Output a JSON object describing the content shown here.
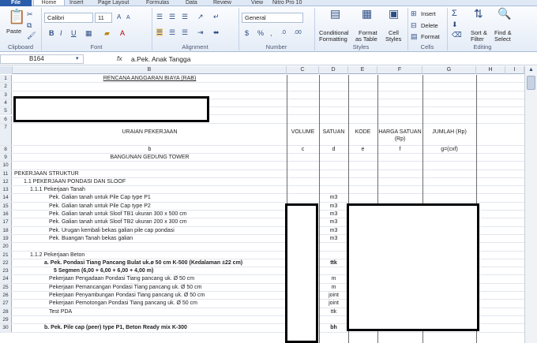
{
  "tabs": {
    "file": "File",
    "home": "Home",
    "insert": "Insert",
    "page_layout": "Page Layout",
    "formulas": "Formulas",
    "data": "Data",
    "review": "Review",
    "view": "View",
    "nitro": "Nitro Pro 10"
  },
  "ribbon": {
    "paste": "Paste",
    "font_name": "Calibri",
    "font_size": "11",
    "number_format": "General",
    "conditional": "Conditional",
    "formatting": "Formatting",
    "format": "Format",
    "as_table": "as Table",
    "cell": "Cell",
    "styles": "Styles",
    "insert": "Insert",
    "delete": "Delete",
    "format_cells": "Format",
    "sum": "Σ",
    "sort": "Sort &",
    "filter": "Filter",
    "find": "Find &",
    "select": "Select",
    "groups": {
      "clipboard": "Clipboard",
      "font": "Font",
      "alignment": "Alignment",
      "number": "Number",
      "styles": "Styles",
      "cells": "Cells",
      "editing": "Editing"
    }
  },
  "formula_bar": {
    "name_box": "B164",
    "fx": "fx",
    "formula": "a.Pek. Anak Tangga"
  },
  "columns": [
    "B",
    "C",
    "D",
    "E",
    "F",
    "G",
    "H",
    "I"
  ],
  "rows": [
    {
      "n": "1",
      "b": "RENCANA ANGGARAN BIAYA (RAB)"
    },
    {
      "n": "2",
      "b": ""
    },
    {
      "n": "3",
      "b": ""
    },
    {
      "n": "4",
      "b": ""
    },
    {
      "n": "5",
      "b": ""
    },
    {
      "n": "6",
      "b": ""
    },
    {
      "n": "7",
      "b": "URAIAN PEKERJAAN",
      "c": "VOLUME",
      "d": "SATUAN",
      "e": "KODE",
      "f": "HARGA SATUAN (Rp)",
      "g": "JUMLAH (Rp)"
    },
    {
      "n": "8",
      "b": "b",
      "c": "c",
      "d": "d",
      "e": "e",
      "f": "f",
      "g": "g=(cxf)"
    },
    {
      "n": "9",
      "b": "BANGUNAN GEDUNG TOWER"
    },
    {
      "n": "10",
      "b": ""
    },
    {
      "n": "11",
      "b": "PEKERJAAN STRUKTUR"
    },
    {
      "n": "12",
      "b": "1.1 PEKERJAAN PONDASI DAN SLOOF"
    },
    {
      "n": "13",
      "b": "1.1.1 Pekerjaan Tanah"
    },
    {
      "n": "14",
      "b": "Pek. Galian tanah untuk Pile Cap type P1",
      "d": "m3"
    },
    {
      "n": "15",
      "b": "Pek. Galian tanah untuk Pile Cap type P2",
      "d": "m3"
    },
    {
      "n": "16",
      "b": "Pek. Galian tanah untuk Sloof TB1 ukuran 300 x 500 cm",
      "d": "m3"
    },
    {
      "n": "17",
      "b": "Pek. Galian tanah untuk Sloof TB2 ukuran 200 x 300 cm",
      "d": "m3"
    },
    {
      "n": "18",
      "b": "Pek. Urugan kembali bekas galian pile cap pondasi",
      "d": "m3"
    },
    {
      "n": "19",
      "b": "Pek. Buangan Tanah bekas galian",
      "d": "m3"
    },
    {
      "n": "20",
      "b": ""
    },
    {
      "n": "21",
      "b": "1.1.2 Pekerjaan Beton"
    },
    {
      "n": "22",
      "b": "a. Pek. Pondasi Tiang Pancang Bulat uk.ø 50 cm K-500 (Kedalaman ±22 cm)",
      "d": "ttk"
    },
    {
      "n": "23",
      "b": "5 Segmen (6,00 + 6,00 + 6,00 + 4,00 m)"
    },
    {
      "n": "24",
      "b": "Pekerjaan Pengadaan Pondasi Tiang pancang uk. Ø 50 cm",
      "d": "m"
    },
    {
      "n": "25",
      "b": "Pekerjaan Pemancangan Pondasi Tiang pancang uk. Ø 50 cm",
      "d": "m"
    },
    {
      "n": "26",
      "b": "Pekerjaan Penyambungan Pondasi Tiang pancang uk. Ø 50 cm",
      "d": "joint"
    },
    {
      "n": "27",
      "b": "Pekerjaan Pemotongan Pondasi Tiang pancang uk. Ø 50 cm",
      "d": "joint"
    },
    {
      "n": "28",
      "b": "Test PDA",
      "d": "ttk"
    },
    {
      "n": "29",
      "b": ""
    },
    {
      "n": "30",
      "b": "b. Pek. Pile cap (peer) type P1, Beton Ready mix K-300",
      "d": "bh"
    }
  ]
}
